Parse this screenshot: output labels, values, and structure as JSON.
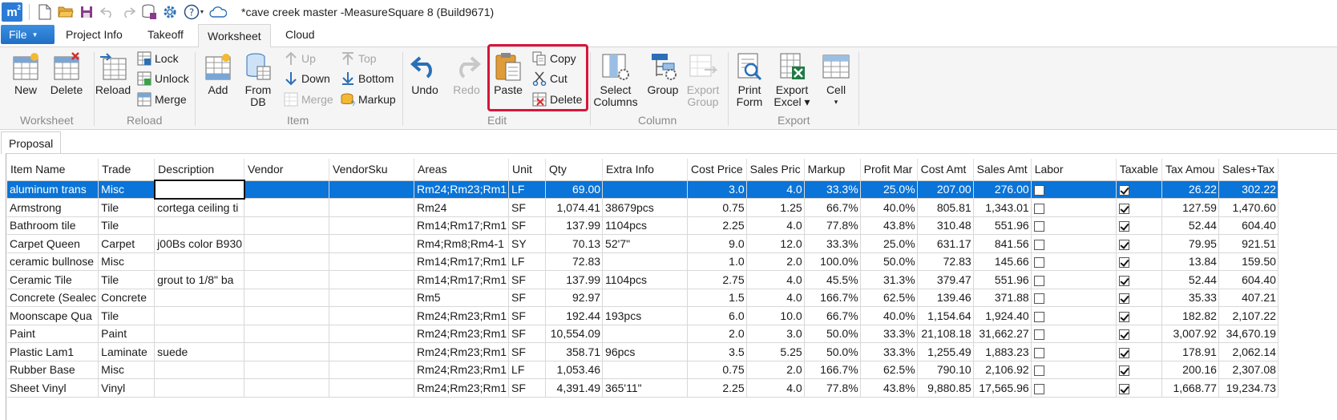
{
  "window": {
    "title": "*cave creek master -MeasureSquare 8 (Build9671)",
    "logo_text": "m",
    "logo_sup": "2"
  },
  "tabs": {
    "file": "File",
    "items": [
      "Project Info",
      "Takeoff",
      "Worksheet",
      "Cloud"
    ],
    "active": "Worksheet"
  },
  "ribbon": {
    "worksheet": {
      "new": "New",
      "delete": "Delete",
      "group": "Worksheet"
    },
    "reload": {
      "reload": "Reload",
      "lock": "Lock",
      "unlock": "Unlock",
      "merge": "Merge",
      "group": "Reload"
    },
    "item": {
      "add": "Add",
      "from_db_1": "From",
      "from_db_2": "DB",
      "up": "Up",
      "down": "Down",
      "merge": "Merge",
      "top": "Top",
      "bottom": "Bottom",
      "markup": "Markup",
      "group": "Item"
    },
    "edit": {
      "undo": "Undo",
      "redo": "Redo",
      "paste": "Paste",
      "copy": "Copy",
      "cut": "Cut",
      "delete": "Delete",
      "group": "Edit"
    },
    "column": {
      "select_1": "Select",
      "select_2": "Columns",
      "group_btn": "Group",
      "export_group_1": "Export",
      "export_group_2": "Group",
      "group": "Column"
    },
    "export": {
      "print_1": "Print",
      "print_2": "Form",
      "excel_1": "Export",
      "excel_2": "Excel ▾",
      "cell_1": "Cell",
      "cell_2": "▾",
      "group": "Export"
    }
  },
  "doc_tab": "Proposal",
  "grid": {
    "columns": [
      "Item Name",
      "Trade",
      "Description",
      "Vendor",
      "VendorSku",
      "Areas",
      "Unit",
      "Qty",
      "Extra Info",
      "Cost Price",
      "Sales Pric",
      "Markup",
      "Profit Mar",
      "Cost Amt",
      "Sales Amt",
      "Labor",
      "Taxable",
      "Tax Amou",
      "Sales+Tax"
    ],
    "rows": [
      {
        "item": "aluminum trans",
        "trade": "Misc",
        "desc": "",
        "vendor": "",
        "sku": "",
        "areas": "Rm24;Rm23;Rm1",
        "unit": "LF",
        "qty": "69.00",
        "extra": "",
        "cost": "3.0",
        "sales": "4.0",
        "markup": "33.3%",
        "profit": "25.0%",
        "cost_amt": "207.00",
        "sales_amt": "276.00",
        "labor": false,
        "taxable": true,
        "tax": "26.22",
        "sales_tax": "302.22"
      },
      {
        "item": "Armstrong",
        "trade": "Tile",
        "desc": "cortega ceiling ti",
        "vendor": "",
        "sku": "",
        "areas": "Rm24",
        "unit": "SF",
        "qty": "1,074.41",
        "extra": "38679pcs",
        "cost": "0.75",
        "sales": "1.25",
        "markup": "66.7%",
        "profit": "40.0%",
        "cost_amt": "805.81",
        "sales_amt": "1,343.01",
        "labor": false,
        "taxable": true,
        "tax": "127.59",
        "sales_tax": "1,470.60"
      },
      {
        "item": "Bathroom tile",
        "trade": "Tile",
        "desc": "",
        "vendor": "",
        "sku": "",
        "areas": "Rm14;Rm17;Rm1",
        "unit": "SF",
        "qty": "137.99",
        "extra": "1104pcs",
        "cost": "2.25",
        "sales": "4.0",
        "markup": "77.8%",
        "profit": "43.8%",
        "cost_amt": "310.48",
        "sales_amt": "551.96",
        "labor": false,
        "taxable": true,
        "tax": "52.44",
        "sales_tax": "604.40"
      },
      {
        "item": "Carpet Queen",
        "trade": "Carpet",
        "desc": "j00Bs color B930",
        "vendor": "",
        "sku": "",
        "areas": "Rm4;Rm8;Rm4-1",
        "unit": "SY",
        "qty": "70.13",
        "extra": "52'7\"",
        "cost": "9.0",
        "sales": "12.0",
        "markup": "33.3%",
        "profit": "25.0%",
        "cost_amt": "631.17",
        "sales_amt": "841.56",
        "labor": false,
        "taxable": true,
        "tax": "79.95",
        "sales_tax": "921.51"
      },
      {
        "item": "ceramic bullnose",
        "trade": "Misc",
        "desc": "",
        "vendor": "",
        "sku": "",
        "areas": "Rm14;Rm17;Rm1",
        "unit": "LF",
        "qty": "72.83",
        "extra": "",
        "cost": "1.0",
        "sales": "2.0",
        "markup": "100.0%",
        "profit": "50.0%",
        "cost_amt": "72.83",
        "sales_amt": "145.66",
        "labor": false,
        "taxable": true,
        "tax": "13.84",
        "sales_tax": "159.50"
      },
      {
        "item": "Ceramic Tile",
        "trade": "Tile",
        "desc": "grout to 1/8\" ba",
        "vendor": "",
        "sku": "",
        "areas": "Rm14;Rm17;Rm1",
        "unit": "SF",
        "qty": "137.99",
        "extra": "1104pcs",
        "cost": "2.75",
        "sales": "4.0",
        "markup": "45.5%",
        "profit": "31.3%",
        "cost_amt": "379.47",
        "sales_amt": "551.96",
        "labor": false,
        "taxable": true,
        "tax": "52.44",
        "sales_tax": "604.40"
      },
      {
        "item": "Concrete (Sealec",
        "trade": "Concrete",
        "desc": "",
        "vendor": "",
        "sku": "",
        "areas": "Rm5",
        "unit": "SF",
        "qty": "92.97",
        "extra": "",
        "cost": "1.5",
        "sales": "4.0",
        "markup": "166.7%",
        "profit": "62.5%",
        "cost_amt": "139.46",
        "sales_amt": "371.88",
        "labor": false,
        "taxable": true,
        "tax": "35.33",
        "sales_tax": "407.21"
      },
      {
        "item": "Moonscape Qua",
        "trade": "Tile",
        "desc": "",
        "vendor": "",
        "sku": "",
        "areas": "Rm24;Rm23;Rm1",
        "unit": "SF",
        "qty": "192.44",
        "extra": "193pcs",
        "cost": "6.0",
        "sales": "10.0",
        "markup": "66.7%",
        "profit": "40.0%",
        "cost_amt": "1,154.64",
        "sales_amt": "1,924.40",
        "labor": false,
        "taxable": true,
        "tax": "182.82",
        "sales_tax": "2,107.22"
      },
      {
        "item": "Paint",
        "trade": "Paint",
        "desc": "",
        "vendor": "",
        "sku": "",
        "areas": "Rm24;Rm23;Rm1",
        "unit": "SF",
        "qty": "10,554.09",
        "extra": "",
        "cost": "2.0",
        "sales": "3.0",
        "markup": "50.0%",
        "profit": "33.3%",
        "cost_amt": "21,108.18",
        "sales_amt": "31,662.27",
        "labor": false,
        "taxable": true,
        "tax": "3,007.92",
        "sales_tax": "34,670.19"
      },
      {
        "item": "Plastic Lam1",
        "trade": "Laminate",
        "desc": "suede",
        "vendor": "",
        "sku": "",
        "areas": "Rm24;Rm23;Rm1",
        "unit": "SF",
        "qty": "358.71",
        "extra": "96pcs",
        "cost": "3.5",
        "sales": "5.25",
        "markup": "50.0%",
        "profit": "33.3%",
        "cost_amt": "1,255.49",
        "sales_amt": "1,883.23",
        "labor": false,
        "taxable": true,
        "tax": "178.91",
        "sales_tax": "2,062.14"
      },
      {
        "item": "Rubber Base",
        "trade": "Misc",
        "desc": "",
        "vendor": "",
        "sku": "",
        "areas": "Rm24;Rm23;Rm1",
        "unit": "LF",
        "qty": "1,053.46",
        "extra": "",
        "cost": "0.75",
        "sales": "2.0",
        "markup": "166.7%",
        "profit": "62.5%",
        "cost_amt": "790.10",
        "sales_amt": "2,106.92",
        "labor": false,
        "taxable": true,
        "tax": "200.16",
        "sales_tax": "2,307.08"
      },
      {
        "item": "Sheet Vinyl",
        "trade": "Vinyl",
        "desc": "",
        "vendor": "",
        "sku": "",
        "areas": "Rm24;Rm23;Rm1",
        "unit": "SF",
        "qty": "4,391.49",
        "extra": "365'11\"",
        "cost": "2.25",
        "sales": "4.0",
        "markup": "77.8%",
        "profit": "43.8%",
        "cost_amt": "9,880.85",
        "sales_amt": "17,565.96",
        "labor": false,
        "taxable": true,
        "tax": "1,668.77",
        "sales_tax": "19,234.73"
      }
    ]
  }
}
